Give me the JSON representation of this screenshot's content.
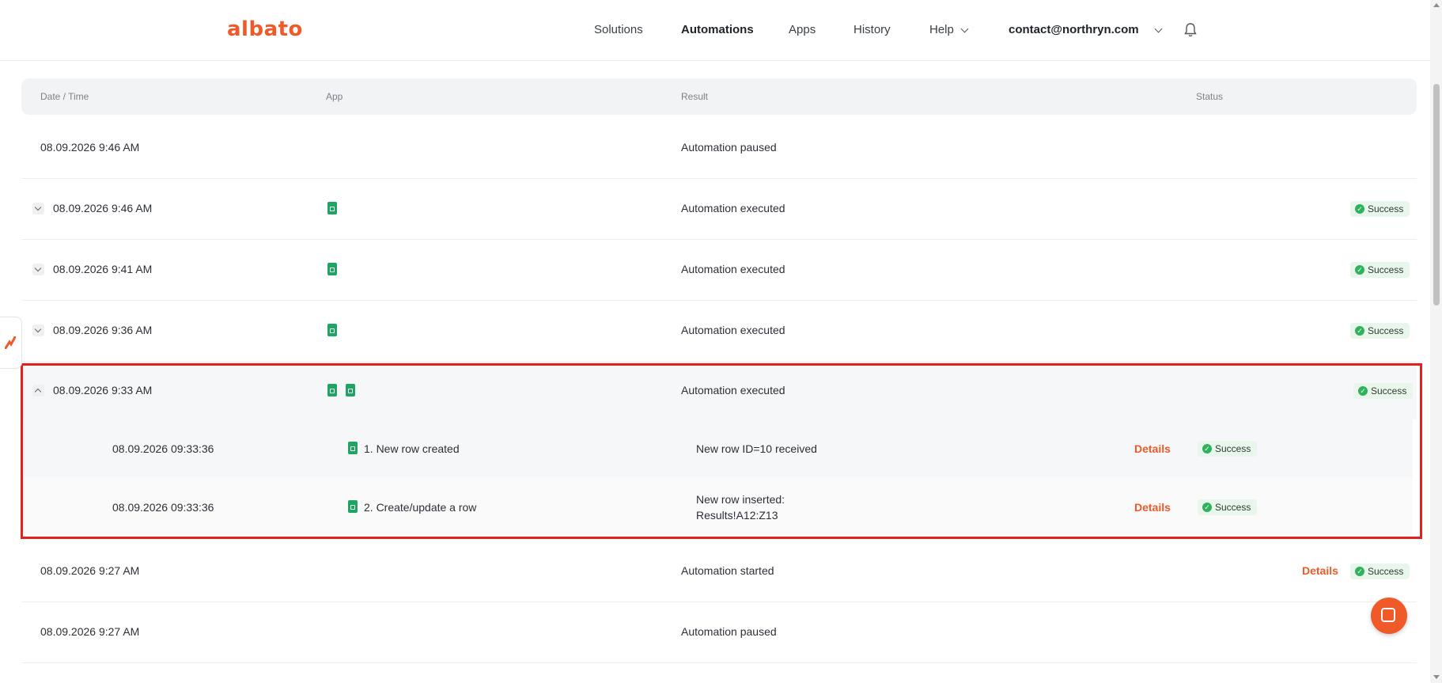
{
  "brand": {
    "logo_text": "albato",
    "accent_color": "#f05a28"
  },
  "nav": {
    "solutions": "Solutions",
    "automations": "Automations",
    "apps": "Apps",
    "history": "History",
    "help": "Help",
    "account": "contact@northryn.com"
  },
  "table": {
    "headers": {
      "datetime": "Date / Time",
      "app": "App",
      "result": "Result",
      "status": "Status"
    },
    "rows": [
      {
        "datetime": "08.09.2026 9:46 AM",
        "result": "Automation paused",
        "status": ""
      },
      {
        "datetime": "08.09.2026 9:46 AM",
        "result": "Automation executed",
        "status": "Success"
      },
      {
        "datetime": "08.09.2026 9:41 AM",
        "result": "Automation executed",
        "status": "Success"
      },
      {
        "datetime": "08.09.2026 9:36 AM",
        "result": "Automation executed",
        "status": "Success"
      },
      {
        "datetime": "08.09.2026 9:33 AM",
        "result": "Automation executed",
        "status": "Success"
      },
      {
        "datetime": "08.09.2026 9:27 AM",
        "result": "Automation started",
        "status": "Success",
        "details": "Details"
      },
      {
        "datetime": "08.09.2026 9:27 AM",
        "result": "Automation paused",
        "status": ""
      }
    ],
    "subrows": [
      {
        "datetime": "08.09.2026 09:33:36",
        "step": "1. New row created",
        "result_line1": "New row ID=10 received",
        "result_line2": "",
        "details": "Details",
        "status": "Success"
      },
      {
        "datetime": "08.09.2026 09:33:36",
        "step": "2. Create/update a row",
        "result_line1": "New row inserted:",
        "result_line2": "Results!A12:Z13",
        "details": "Details",
        "status": "Success"
      }
    ]
  },
  "icons": {
    "sheets": "google-sheets-icon",
    "bell": "bell-icon",
    "chat": "chat-icon"
  },
  "colors": {
    "success_bg": "#e8f6ec",
    "success_dot": "#2fb25b",
    "highlight_border": "#e3201c"
  }
}
